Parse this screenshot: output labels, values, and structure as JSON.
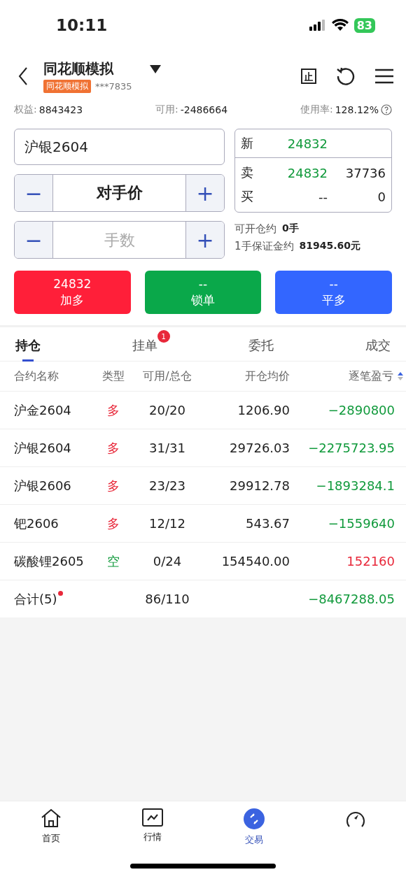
{
  "status_bar": {
    "time": "10:11",
    "battery": "83"
  },
  "header": {
    "title": "同花顺模拟",
    "badge": "同花顺模拟",
    "account": "***7835"
  },
  "account_stats": [
    {
      "label": "权益:",
      "value": "8843423"
    },
    {
      "label": "可用:",
      "value": "-2486664"
    },
    {
      "label": "使用率:",
      "value": "128.12%"
    }
  ],
  "order": {
    "contract": "沪银2604",
    "price": "对手价",
    "quantity_placeholder": "手数",
    "minus": "−",
    "plus": "+"
  },
  "quote": {
    "rows": [
      {
        "label": "新",
        "price": "24832"
      },
      {
        "label": "卖",
        "price": "24832",
        "volume": "37736"
      },
      {
        "label": "买",
        "price": "--",
        "volume": "0"
      }
    ]
  },
  "margin_info": [
    {
      "label": "可开仓约",
      "value": "0手"
    },
    {
      "label": "1手保证金约",
      "value": "81945.60元"
    }
  ],
  "action_buttons": [
    {
      "price": "24832",
      "label": "加多",
      "kind": "buy"
    },
    {
      "price": "--",
      "label": "锁单",
      "kind": "lock"
    },
    {
      "price": "--",
      "label": "平多",
      "kind": "close"
    }
  ],
  "tabs": [
    {
      "label": "持仓",
      "selected": true
    },
    {
      "label": "挂单",
      "selected": false,
      "badge": "1"
    },
    {
      "label": "委托",
      "selected": false
    },
    {
      "label": "成交",
      "selected": false
    }
  ],
  "table": {
    "columns": [
      "合约名称",
      "类型",
      "可用/总仓",
      "开仓均价",
      "逐笔盈亏"
    ],
    "rows": [
      {
        "name": "沪金2604",
        "type": {
          "text": "多",
          "color": "#e8283a"
        },
        "position": "20/20",
        "avg_price": "1206.90",
        "pnl": {
          "text": "−2890800",
          "color": "#119a3c"
        }
      },
      {
        "name": "沪银2604",
        "type": {
          "text": "多",
          "color": "#e8283a"
        },
        "position": "31/31",
        "avg_price": "29726.03",
        "pnl": {
          "text": "−2275723.95",
          "color": "#119a3c"
        }
      },
      {
        "name": "沪银2606",
        "type": {
          "text": "多",
          "color": "#e8283a"
        },
        "position": "23/23",
        "avg_price": "29912.78",
        "pnl": {
          "text": "−1893284.1",
          "color": "#119a3c"
        }
      },
      {
        "name": "钯2606",
        "type": {
          "text": "多",
          "color": "#e8283a"
        },
        "position": "12/12",
        "avg_price": "543.67",
        "pnl": {
          "text": "−1559640",
          "color": "#119a3c"
        }
      },
      {
        "name": "碳酸锂2605",
        "type": {
          "text": "空",
          "color": "#119a3c"
        },
        "position": "0/24",
        "avg_price": "154540.00",
        "pnl": {
          "text": "152160",
          "color": "#e8283a"
        }
      }
    ],
    "total": {
      "label": "合计(5)",
      "dot": true,
      "position": "86/110",
      "pnl": {
        "text": "−8467288.05",
        "color": "#119a3c"
      }
    }
  },
  "tab_bar": [
    {
      "label": "首页",
      "selected": false
    },
    {
      "label": "行情",
      "selected": false
    },
    {
      "label": "交易",
      "selected": true
    },
    {
      "selected": false
    }
  ]
}
